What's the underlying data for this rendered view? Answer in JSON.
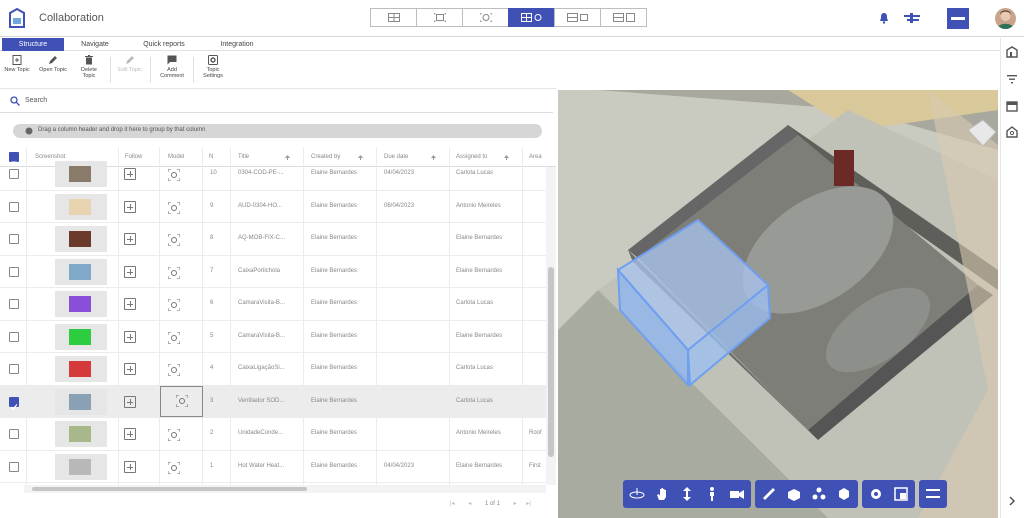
{
  "app": {
    "title": "Collaboration"
  },
  "tabs": [
    {
      "label": "Structure",
      "active": true
    },
    {
      "label": "Navigate",
      "active": false
    },
    {
      "label": "Quick reports",
      "active": false
    },
    {
      "label": "Integration",
      "active": false
    }
  ],
  "toolbar": {
    "new_topic": "New Topic",
    "open_topic": "Open Topic",
    "delete_topic": "Delete Topic",
    "edit_topic": "Edit Topic",
    "add_comment": "Add Comment",
    "topic_settings": "Topic Settings"
  },
  "search": {
    "label": "Search"
  },
  "group_hint": "Drag a column header and drop it here to group by that column",
  "columns": [
    "Screenshot",
    "Follow",
    "Model",
    "N",
    "Title",
    "Created by",
    "Due date",
    "Assigned to",
    "Area"
  ],
  "rows": [
    {
      "n": "10",
      "title": "0304-COD-PE-...",
      "created_by": "Elaine Bernardes",
      "due": "04/04/2023",
      "assigned": "Carlota Lucas",
      "area": "",
      "selected": false,
      "thumb_color": "#8a7a6a"
    },
    {
      "n": "9",
      "title": "AUD-0304-HO...",
      "created_by": "Elaine Bernardes",
      "due": "06/04/2023",
      "assigned": "Antonio Meireles",
      "area": "",
      "selected": false,
      "thumb_color": "#e8d4b0"
    },
    {
      "n": "8",
      "title": "AQ-MOB-FIX-C...",
      "created_by": "Elaine Bernardes",
      "due": "",
      "assigned": "Elaine Bernardes",
      "area": "",
      "selected": false,
      "thumb_color": "#6b3a2a"
    },
    {
      "n": "7",
      "title": "CaixaPortichola",
      "created_by": "Elaine Bernardes",
      "due": "",
      "assigned": "Elaine Bernardes",
      "area": "",
      "selected": false,
      "thumb_color": "#7fa8c9"
    },
    {
      "n": "6",
      "title": "CamaraVisita-B...",
      "created_by": "Elaine Bernardes",
      "due": "",
      "assigned": "Carlota Lucas",
      "area": "",
      "selected": false,
      "thumb_color": "#8a4fd8"
    },
    {
      "n": "5",
      "title": "CamaraVisita-B...",
      "created_by": "Elaine Bernardes",
      "due": "",
      "assigned": "Elaine Bernardes",
      "area": "",
      "selected": false,
      "thumb_color": "#2ecc40"
    },
    {
      "n": "4",
      "title": "CaixaLigaçãoSi...",
      "created_by": "Elaine Bernardes",
      "due": "",
      "assigned": "Carlota Lucas",
      "area": "",
      "selected": false,
      "thumb_color": "#d43a3a"
    },
    {
      "n": "3",
      "title": "Ventilador SOD...",
      "created_by": "Elaine Bernardes",
      "due": "",
      "assigned": "Carlota Lucas",
      "area": "",
      "selected": true,
      "thumb_color": "#8aa0b4"
    },
    {
      "n": "2",
      "title": "UnidadeConde...",
      "created_by": "Elaine Bernardes",
      "due": "",
      "assigned": "Antonio Meireles",
      "area": "Roof",
      "selected": false,
      "thumb_color": "#a8b88a"
    },
    {
      "n": "1",
      "title": "Hot Water Heat...",
      "created_by": "Elaine Bernardes",
      "due": "04/04/2023",
      "assigned": "Elaine Bernardes",
      "area": "First",
      "selected": false,
      "thumb_color": "#b8b8b8"
    }
  ],
  "pager": {
    "text": "1 of 1"
  },
  "colors": {
    "accent": "#3f51b5"
  }
}
